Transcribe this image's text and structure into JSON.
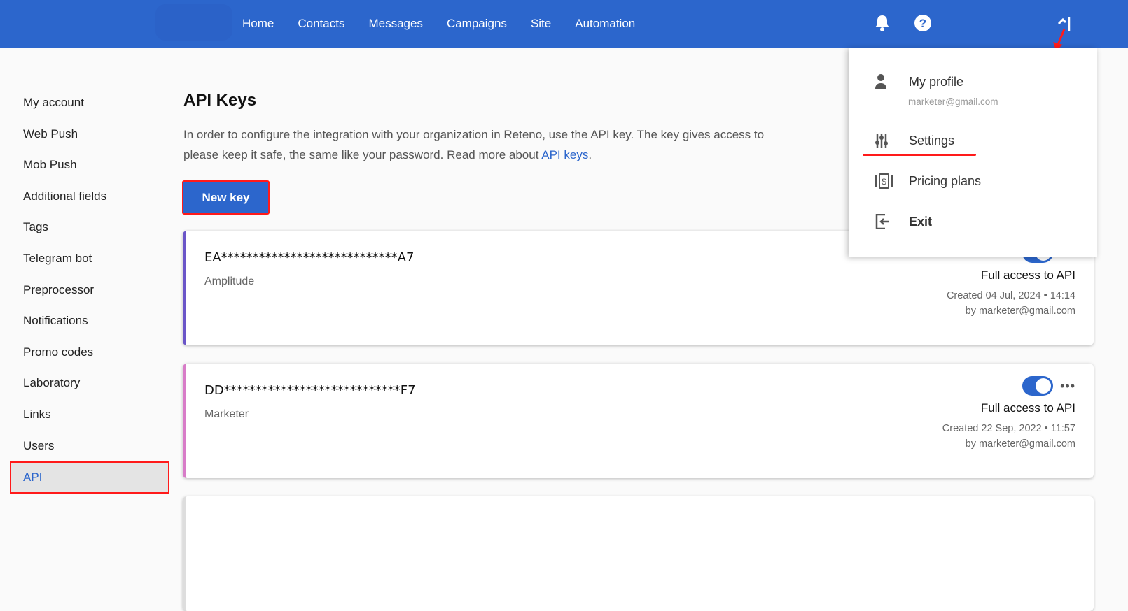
{
  "nav": {
    "items": [
      "Home",
      "Contacts",
      "Messages",
      "Campaigns",
      "Site",
      "Automation"
    ]
  },
  "sidebar": {
    "items": [
      "My account",
      "Web Push",
      "Mob Push",
      "Additional fields",
      "Tags",
      "Telegram bot",
      "Preprocessor",
      "Notifications",
      "Promo codes",
      "Laboratory",
      "Links",
      "Users",
      "API"
    ],
    "active": "API"
  },
  "page": {
    "title": "API Keys",
    "desc_1": "In order to configure the integration with your organization in Reteno, use the API key. The key gives access to",
    "desc_2": "please keep it safe, the same like your password. Read more about ",
    "desc_link": "API keys",
    "desc_end": ".",
    "new_key": "New key"
  },
  "keys": [
    {
      "key": "EA****************************A7",
      "name": "Amplitude",
      "access": "Full access to API",
      "created": "Created  04 Jul, 2024 • 14:14",
      "by": "by marketer@gmail.com",
      "color": "#6a55c8"
    },
    {
      "key": "DD****************************F7",
      "name": "Marketer",
      "access": "Full access to API",
      "created": "Created  22 Sep, 2022 • 11:57",
      "by": "by marketer@gmail.com",
      "color": "#d87cc8"
    }
  ],
  "menu": {
    "profile": "My profile",
    "email": "marketer@gmail.com",
    "settings": "Settings",
    "pricing": "Pricing plans",
    "exit": "Exit"
  },
  "colors": {
    "brand": "#2c66cc",
    "highlight": "#ff1a1a"
  }
}
